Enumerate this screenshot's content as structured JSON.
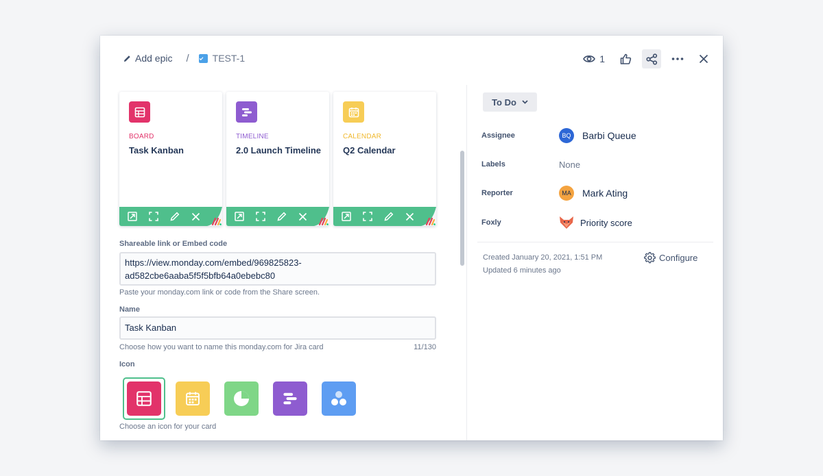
{
  "header": {
    "add_epic_label": "Add epic",
    "separator": "/",
    "issue_key": "TEST-1",
    "watch_count": "1",
    "actions": [
      "eye-icon",
      "thumbs-up-icon",
      "share-icon",
      "more-icon",
      "close-icon"
    ]
  },
  "cards": [
    {
      "type": "BOARD",
      "title": "Task Kanban",
      "color": "#e2336a",
      "type_color": "#e2336a",
      "icon": "table-icon"
    },
    {
      "type": "TIMELINE",
      "title": "2.0 Launch Timeline",
      "color": "#8e5cd0",
      "type_color": "#8e5cd0",
      "icon": "timeline-icon"
    },
    {
      "type": "CALENDAR",
      "title": "Q2 Calendar",
      "color": "#f7cd56",
      "type_color": "#f0b82d",
      "icon": "calendar-icon"
    }
  ],
  "toolbar_color": "#4fbf8c",
  "form": {
    "link_label": "Shareable link or Embed code",
    "link_value_line1": "https://view.monday.com/embed/969825823-",
    "link_value_line2": "ad582cbe6aaba5f5f5bfb64a0ebebc80",
    "link_help": "Paste your monday.com link or code from the Share screen.",
    "name_label": "Name",
    "name_value": "Task Kanban",
    "name_help": "Choose how you want to name this monday.com for Jira card",
    "name_counter": "11/130",
    "icon_label": "Icon",
    "icon_help": "Choose an icon for your card",
    "icon_options": [
      {
        "name": "table-icon",
        "color": "#e2336a",
        "selected": true
      },
      {
        "name": "calendar-icon",
        "color": "#f7cd56",
        "selected": false
      },
      {
        "name": "pie-chart-icon",
        "color": "#7fd687",
        "selected": false
      },
      {
        "name": "timeline-icon",
        "color": "#8e5cd0",
        "selected": false
      },
      {
        "name": "dots-icon",
        "color": "#5e9df2",
        "selected": false
      }
    ]
  },
  "details": {
    "status": "To Do",
    "assignee_label": "Assignee",
    "assignee_initials": "BQ",
    "assignee_name": "Barbi Queue",
    "assignee_color": "#2d67d6",
    "labels_label": "Labels",
    "labels_value": "None",
    "reporter_label": "Reporter",
    "reporter_initials": "MA",
    "reporter_name": "Mark Ating",
    "reporter_color": "#f4a340",
    "foxly_label": "Foxly",
    "foxly_value": "Priority score",
    "created": "Created January 20, 2021, 1:51 PM",
    "updated": "Updated 6 minutes ago",
    "configure_label": "Configure"
  }
}
